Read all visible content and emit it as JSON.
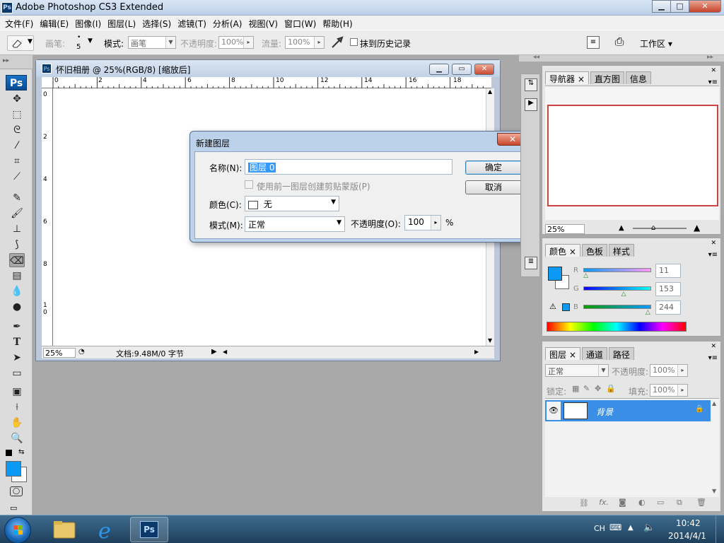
{
  "app": {
    "title": "Adobe Photoshop CS3 Extended",
    "logo": "Ps",
    "window_buttons": {
      "min": "▁",
      "max": "□",
      "close": "✕"
    }
  },
  "menu": [
    "文件(F)",
    "编辑(E)",
    "图像(I)",
    "图层(L)",
    "选择(S)",
    "滤镜(T)",
    "分析(A)",
    "视图(V)",
    "窗口(W)",
    "帮助(H)"
  ],
  "options": {
    "brush_label": "画笔:",
    "brush_size": "5",
    "mode_label": "模式:",
    "mode_value": "画笔",
    "opacity_label": "不透明度:",
    "opacity_value": "100%",
    "flow_label": "流量:",
    "flow_value": "100%",
    "erase_history": "抹到历史记录",
    "workspace": "工作区 ▾"
  },
  "toolbox": {
    "logo": "Ps",
    "header": "▸▸"
  },
  "document": {
    "title": "怀旧相册 @ 25%(RGB/8) [缩放后]",
    "ruler_top": [
      "0",
      "2",
      "4",
      "6",
      "8",
      "10",
      "12",
      "14",
      "16",
      "18"
    ],
    "ruler_left": [
      "0",
      "2",
      "4",
      "6",
      "8",
      "1\n0"
    ],
    "zoom": "25%",
    "doc_info": "文档:9.48M/0 字节"
  },
  "dialog": {
    "title": "新建图层",
    "close": "✕",
    "name_label": "名称(N):",
    "name_value": "图层 0",
    "clip_label": "使用前一图层创建剪贴蒙版(P)",
    "color_label": "颜色(C):",
    "color_value": "无",
    "mode_label": "模式(M):",
    "mode_value": "正常",
    "opacity_label": "不透明度(O):",
    "opacity_value": "100",
    "opacity_unit": "%",
    "ok": "确定",
    "cancel": "取消"
  },
  "navigator": {
    "tabs": [
      "导航器 ×",
      "直方图",
      "信息"
    ],
    "zoom": "25%"
  },
  "color_panel": {
    "tabs": [
      "颜色 ×",
      "色板",
      "样式"
    ],
    "r_label": "R",
    "r_value": "11",
    "g_label": "G",
    "g_value": "153",
    "b_label": "B",
    "b_value": "244",
    "fg_color": "#0b99f4",
    "r": 11,
    "g": 153,
    "b": 244
  },
  "layers_panel": {
    "tabs": [
      "图层 ×",
      "通道",
      "路径"
    ],
    "blend": "正常",
    "opacity_label": "不透明度:",
    "opacity_value": "100%",
    "lock_label": "锁定:",
    "fill_label": "填充:",
    "fill_value": "100%",
    "layer_name": "背景"
  },
  "taskbar": {
    "lang": "CH",
    "time": "10:42",
    "date": "2014/4/1"
  }
}
